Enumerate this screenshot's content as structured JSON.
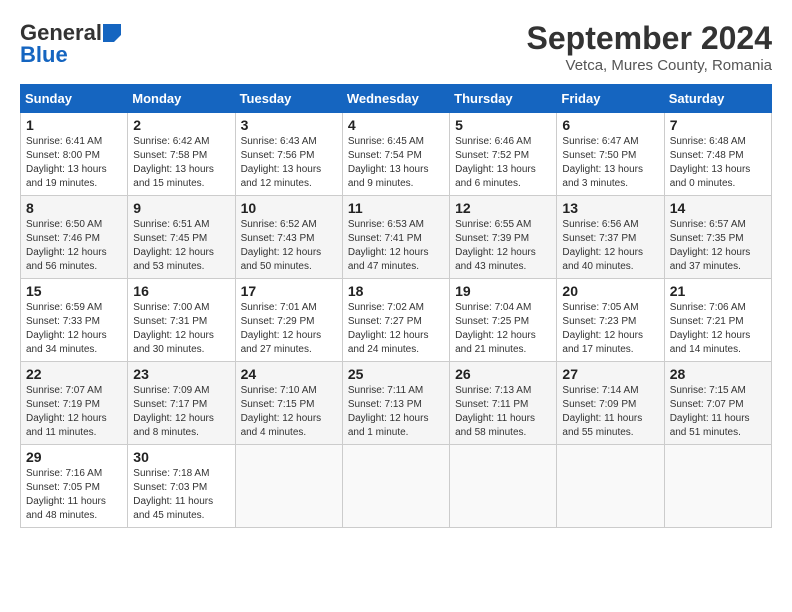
{
  "header": {
    "logo_line1": "General",
    "logo_line2": "Blue",
    "title": "September 2024",
    "subtitle": "Vetca, Mures County, Romania"
  },
  "calendar": {
    "days_of_week": [
      "Sunday",
      "Monday",
      "Tuesday",
      "Wednesday",
      "Thursday",
      "Friday",
      "Saturday"
    ],
    "weeks": [
      [
        {
          "day": "",
          "info": ""
        },
        {
          "day": "",
          "info": ""
        },
        {
          "day": "",
          "info": ""
        },
        {
          "day": "",
          "info": ""
        },
        {
          "day": "",
          "info": ""
        },
        {
          "day": "",
          "info": ""
        },
        {
          "day": "1",
          "info": "Sunrise: 6:41 AM\nSunset: 8:00 PM\nDaylight: 13 hours and 19 minutes."
        }
      ],
      [
        {
          "day": "2",
          "info": "Sunrise: 6:42 AM\nSunset: 7:58 PM\nDaylight: 13 hours and 15 minutes."
        },
        {
          "day": "3",
          "info": "Sunrise: 6:43 AM\nSunset: 7:56 PM\nDaylight: 13 hours and 12 minutes."
        },
        {
          "day": "4",
          "info": "Sunrise: 6:45 AM\nSunset: 7:54 PM\nDaylight: 13 hours and 9 minutes."
        },
        {
          "day": "5",
          "info": "Sunrise: 6:46 AM\nSunset: 7:52 PM\nDaylight: 13 hours and 6 minutes."
        },
        {
          "day": "6",
          "info": "Sunrise: 6:47 AM\nSunset: 7:50 PM\nDaylight: 13 hours and 3 minutes."
        },
        {
          "day": "7",
          "info": "Sunrise: 6:48 AM\nSunset: 7:48 PM\nDaylight: 13 hours and 0 minutes."
        }
      ],
      [
        {
          "day": "8",
          "info": "Sunrise: 6:50 AM\nSunset: 7:46 PM\nDaylight: 12 hours and 56 minutes."
        },
        {
          "day": "9",
          "info": "Sunrise: 6:51 AM\nSunset: 7:45 PM\nDaylight: 12 hours and 53 minutes."
        },
        {
          "day": "10",
          "info": "Sunrise: 6:52 AM\nSunset: 7:43 PM\nDaylight: 12 hours and 50 minutes."
        },
        {
          "day": "11",
          "info": "Sunrise: 6:53 AM\nSunset: 7:41 PM\nDaylight: 12 hours and 47 minutes."
        },
        {
          "day": "12",
          "info": "Sunrise: 6:55 AM\nSunset: 7:39 PM\nDaylight: 12 hours and 43 minutes."
        },
        {
          "day": "13",
          "info": "Sunrise: 6:56 AM\nSunset: 7:37 PM\nDaylight: 12 hours and 40 minutes."
        },
        {
          "day": "14",
          "info": "Sunrise: 6:57 AM\nSunset: 7:35 PM\nDaylight: 12 hours and 37 minutes."
        }
      ],
      [
        {
          "day": "15",
          "info": "Sunrise: 6:59 AM\nSunset: 7:33 PM\nDaylight: 12 hours and 34 minutes."
        },
        {
          "day": "16",
          "info": "Sunrise: 7:00 AM\nSunset: 7:31 PM\nDaylight: 12 hours and 30 minutes."
        },
        {
          "day": "17",
          "info": "Sunrise: 7:01 AM\nSunset: 7:29 PM\nDaylight: 12 hours and 27 minutes."
        },
        {
          "day": "18",
          "info": "Sunrise: 7:02 AM\nSunset: 7:27 PM\nDaylight: 12 hours and 24 minutes."
        },
        {
          "day": "19",
          "info": "Sunrise: 7:04 AM\nSunset: 7:25 PM\nDaylight: 12 hours and 21 minutes."
        },
        {
          "day": "20",
          "info": "Sunrise: 7:05 AM\nSunset: 7:23 PM\nDaylight: 12 hours and 17 minutes."
        },
        {
          "day": "21",
          "info": "Sunrise: 7:06 AM\nSunset: 7:21 PM\nDaylight: 12 hours and 14 minutes."
        }
      ],
      [
        {
          "day": "22",
          "info": "Sunrise: 7:07 AM\nSunset: 7:19 PM\nDaylight: 12 hours and 11 minutes."
        },
        {
          "day": "23",
          "info": "Sunrise: 7:09 AM\nSunset: 7:17 PM\nDaylight: 12 hours and 8 minutes."
        },
        {
          "day": "24",
          "info": "Sunrise: 7:10 AM\nSunset: 7:15 PM\nDaylight: 12 hours and 4 minutes."
        },
        {
          "day": "25",
          "info": "Sunrise: 7:11 AM\nSunset: 7:13 PM\nDaylight: 12 hours and 1 minute."
        },
        {
          "day": "26",
          "info": "Sunrise: 7:13 AM\nSunset: 7:11 PM\nDaylight: 11 hours and 58 minutes."
        },
        {
          "day": "27",
          "info": "Sunrise: 7:14 AM\nSunset: 7:09 PM\nDaylight: 11 hours and 55 minutes."
        },
        {
          "day": "28",
          "info": "Sunrise: 7:15 AM\nSunset: 7:07 PM\nDaylight: 11 hours and 51 minutes."
        }
      ],
      [
        {
          "day": "29",
          "info": "Sunrise: 7:16 AM\nSunset: 7:05 PM\nDaylight: 11 hours and 48 minutes."
        },
        {
          "day": "30",
          "info": "Sunrise: 7:18 AM\nSunset: 7:03 PM\nDaylight: 11 hours and 45 minutes."
        },
        {
          "day": "",
          "info": ""
        },
        {
          "day": "",
          "info": ""
        },
        {
          "day": "",
          "info": ""
        },
        {
          "day": "",
          "info": ""
        },
        {
          "day": "",
          "info": ""
        }
      ]
    ]
  }
}
